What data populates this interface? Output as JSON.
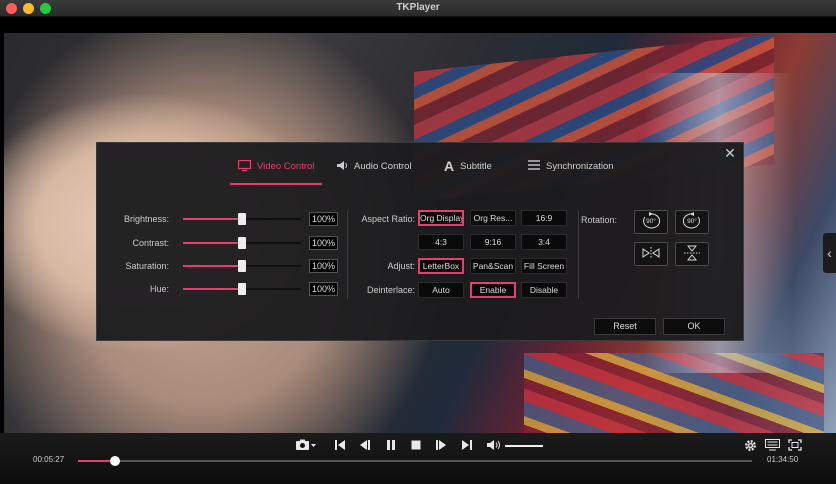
{
  "window": {
    "title": "TKPlayer"
  },
  "dialog": {
    "close_label": "✕",
    "tabs": [
      {
        "label": "Video Control",
        "active": true
      },
      {
        "label": "Audio Control",
        "active": false
      },
      {
        "label": "Subtitle",
        "active": false
      },
      {
        "label": "Synchronization",
        "active": false
      }
    ],
    "sliders": [
      {
        "label": "Brightness:",
        "value": "100%",
        "level": 0.5
      },
      {
        "label": "Contrast:",
        "value": "100%",
        "level": 0.5
      },
      {
        "label": "Saturation:",
        "value": "100%",
        "level": 0.5
      },
      {
        "label": "Hue:",
        "value": "100%",
        "level": 0.5
      }
    ],
    "aspect_ratio": {
      "label": "Aspect Ratio:",
      "options": [
        "Org Display",
        "Org Res...",
        "16:9",
        "4:3",
        "9:16",
        "3:4"
      ],
      "selected": "Org Display"
    },
    "adjust": {
      "label": "Adjust:",
      "options": [
        "LetterBox",
        "Pan&Scan",
        "Fill Screen"
      ],
      "selected": "LetterBox"
    },
    "deinterlace": {
      "label": "Deinterlace:",
      "options": [
        "Auto",
        "Enable",
        "Disable"
      ],
      "selected": "Enable"
    },
    "rotation": {
      "label": "Rotation:",
      "rotate_left": "90°",
      "rotate_right": "90°"
    },
    "reset_label": "Reset",
    "ok_label": "OK"
  },
  "player": {
    "current_time": "00:05:27",
    "total_time": "01:34:50",
    "progress": 0.055,
    "volume": 1.0
  },
  "colors": {
    "accent": "#e2416e"
  }
}
